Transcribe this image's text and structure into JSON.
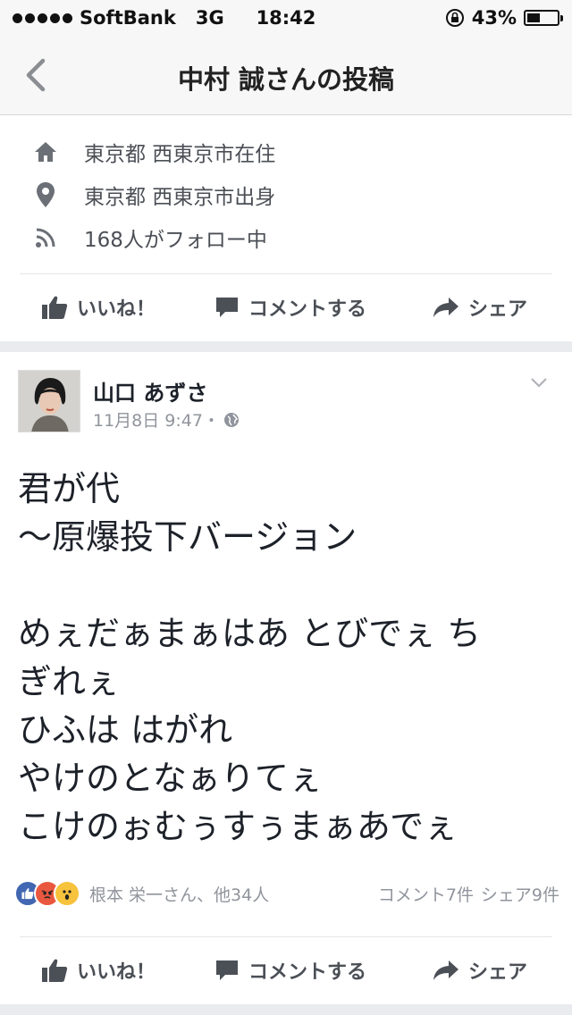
{
  "status_bar": {
    "carrier": "SoftBank",
    "network": "3G",
    "time": "18:42",
    "battery_percent": "43%",
    "battery_level": 0.43
  },
  "nav": {
    "title": "中村 誠さんの投稿",
    "back_icon": "chevron-left-icon"
  },
  "profile_info": [
    {
      "icon": "home-icon",
      "text": "東京都 西東京市在住"
    },
    {
      "icon": "location-pin-icon",
      "text": "東京都 西東京市出身"
    },
    {
      "icon": "rss-icon",
      "text": "168人がフォロー中"
    }
  ],
  "actions": {
    "like": "いいね！",
    "comment": "コメントする",
    "share": "シェア"
  },
  "post": {
    "author": "山口 あずさ",
    "date": "11月8日 9:47・",
    "lines": [
      "君が代",
      "〜原爆投下バージョン",
      "",
      "めぇだぁまぁはあ とびでぇ ち",
      "ぎれぇ",
      "ひふは はがれ",
      "やけのとなぁりてぇ",
      "こけのぉむぅすぅまぁあでぇ"
    ],
    "reactions_text": "根本 栄一さん、他34人",
    "comments_count": "コメント7件",
    "shares_count": "シェア9件"
  },
  "colors": {
    "background": "#ffffff",
    "separator": "#e9ebee",
    "secondary_text": "#90949c",
    "like_blue": "#4267b2"
  }
}
